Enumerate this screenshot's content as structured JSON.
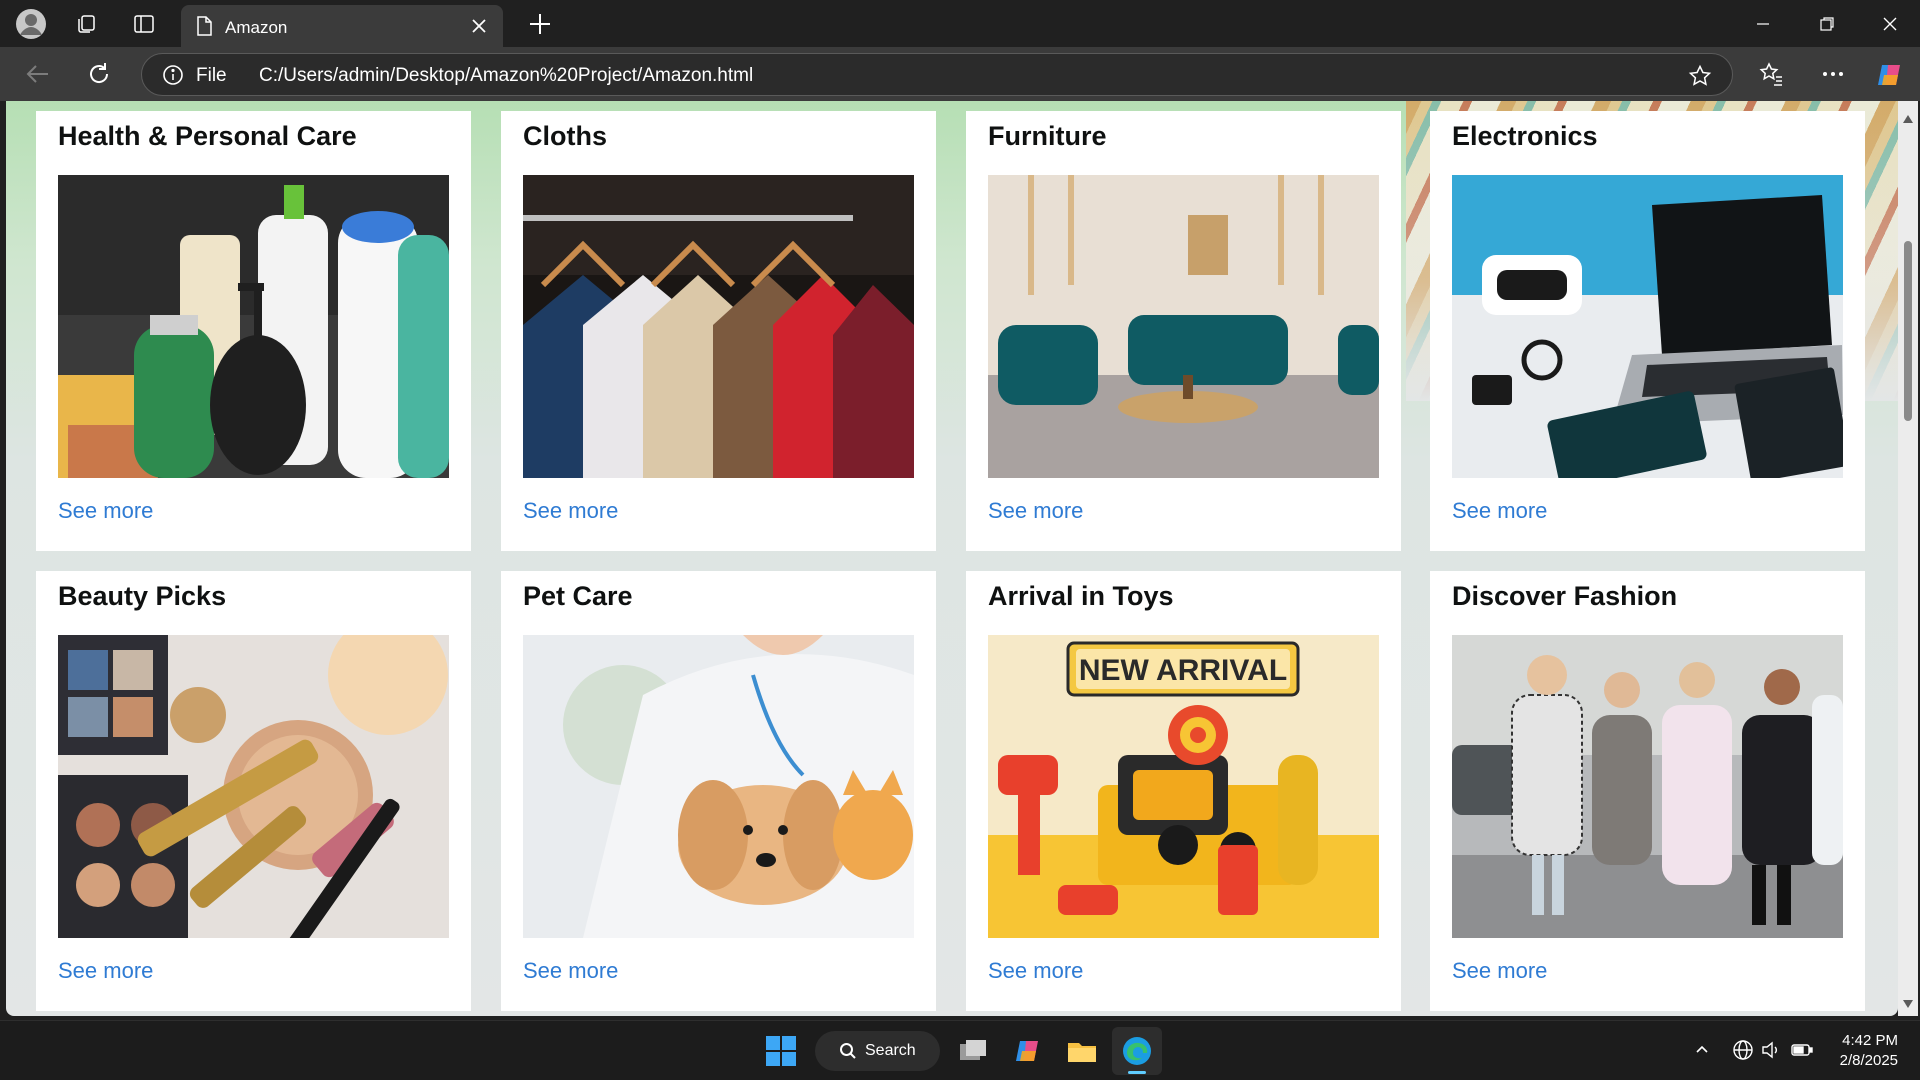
{
  "browser": {
    "tab_title": "Amazon",
    "address_label": "File",
    "url": "C:/Users/admin/Desktop/Amazon%20Project/Amazon.html"
  },
  "cards": [
    {
      "title": "Health & Personal Care",
      "link": "See more",
      "image": "personal-care-products"
    },
    {
      "title": "Cloths",
      "link": "See more",
      "image": "clothes-on-hangers"
    },
    {
      "title": "Furniture",
      "link": "See more",
      "image": "living-room-furniture"
    },
    {
      "title": "Electronics",
      "link": "See more",
      "image": "laptop-and-gadgets"
    },
    {
      "title": "Beauty Picks",
      "link": "See more",
      "image": "makeup-products"
    },
    {
      "title": "Pet Care",
      "link": "See more",
      "image": "vet-with-dog-and-kitten"
    },
    {
      "title": "Arrival in Toys",
      "link": "See more",
      "image": "toys-display",
      "image_text": "NEW ARRIVAL"
    },
    {
      "title": "Discover Fashion",
      "link": "See more",
      "image": "street-fashion-women"
    }
  ],
  "taskbar": {
    "search_label": "Search",
    "time": "4:42 PM",
    "date": "2/8/2025"
  },
  "colors": {
    "link": "#2f7bd3",
    "chrome_dark": "#202020",
    "toolbar": "#3b3b3b"
  }
}
